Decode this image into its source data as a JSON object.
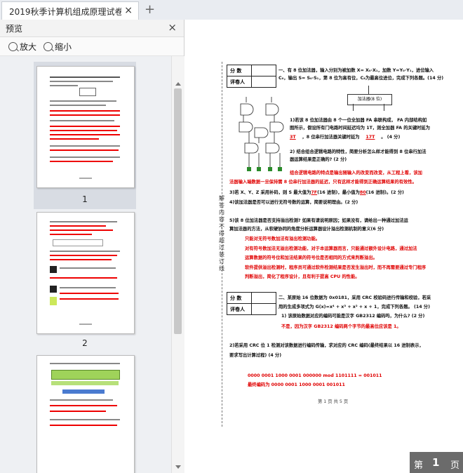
{
  "tab": {
    "title": "2019秋季计算机组成原理试卷A",
    "close": "×",
    "add": "+"
  },
  "preview": {
    "title": "预览",
    "close": "×",
    "zoom_in": "放大",
    "zoom_out": "缩小",
    "pages": [
      "1",
      "2"
    ]
  },
  "cut_line": "解答内容不得超过装订线",
  "score_table": {
    "score": "分 数",
    "grader": "评卷人"
  },
  "adder_label": "加法器(8 位)",
  "q1": {
    "title": "一、有 8 位加法器，输入分别为被加数 X= X₀·X₁，加数 Y=Y₀·Y₁，进位输入",
    "title2": "C₀，输出 S= S₀·S₁，第 8 位为高有位，C₈为最高位进位，完成下列各题。(14 分)",
    "p1a": "1)若该 8 位加法器由 8 个一位全加器 FA 串联构成， FA 内部结构如",
    "p1b": "图所示，假设所有门电路时间延迟均为 1T，则全加器 FA 的关键时延为",
    "ans1": "3T",
    "p1c": "，8 位串行加法器关键时延为",
    "ans2": "17T",
    "p1d": "。 (4 分)",
    "p2a": "2) 结合组合逻辑电路的特性，简要分析怎么样才能得到 8 位串行加法",
    "p2b": "器运算结果是正确的? (2 分)",
    "r2a": "组合逻辑电路的特点是输出随输入的改变而改变，从工程上看，该加",
    "r2b": "法器输入端数据一旦保持需 8 位串行加法器的延迟，只有这样才能得到正确运算结果的有效性。",
    "p3": "3)若 X、Y、Z 采用补码，则 S 最大值为",
    "ans3": "7F",
    "p3b": "(16 进制)，最小值为",
    "ans4": "80",
    "p3c": "(16 进制)。(2 分)",
    "p4": "4)该加法器是否可以进行无符号数的运算，简要说明理由。(2 分)",
    "p5a": "5)该 8 位加法器是否支持溢出检测? 如果有请说明原因；如果没有，请给出一种通过加法运",
    "p5b": "算加法器的方法，从软硬协同的角度分析运算器设计溢出检测机制的意义(6 分)",
    "r5a": "只能对无符号数加法有溢出检测功能。",
    "r5b": "对有符号数加法无溢出检测功能，对于本运算器而言，只能通过额外设计电路，通过加法",
    "r5c": "运算数据的符号位和加法结果的符号位是否相同的方式来判断溢出。",
    "r5d": "软件提供溢出检测时，程序员可通过软件检测结果是否发生溢出时，而不再需要通过专门程序",
    "r5e": "判断溢出，简化了程序设计，且有利于提高 CPU 的性能。"
  },
  "q2": {
    "t1": "二、某原始 16 位数据为 0x0181，采用 CRC 校验码进行传输和校验，若采",
    "t2": "用的生成多项式为 G(x)=x⁴ + x³ + x² + x + 1，完成下列各题。 (14 分)",
    "p1": "1) 该原始数据对应的编码可能是汉字 GB2312 编码吗，为什么? (2 分)",
    "r1": "不是，因为汉字 GB2312 编码两个字节的最高位应该是 1。",
    "p2a": "2)若采用 CRC 位 1 检测对该数据进行编码传输，求对应的 CRC 编码(最终结果以 16 进制表示，",
    "p2b": "要求写出计算过程) (4 分)",
    "c1": "0000 0001 1000 0001 000000 mod 1101111 = 001011",
    "c2": "最终编码为 0000 0001 1000 0001 001011"
  },
  "footer": "第 1 页  共 5 页",
  "pager": {
    "prefix": "第",
    "num": "1",
    "suffix": "页"
  }
}
